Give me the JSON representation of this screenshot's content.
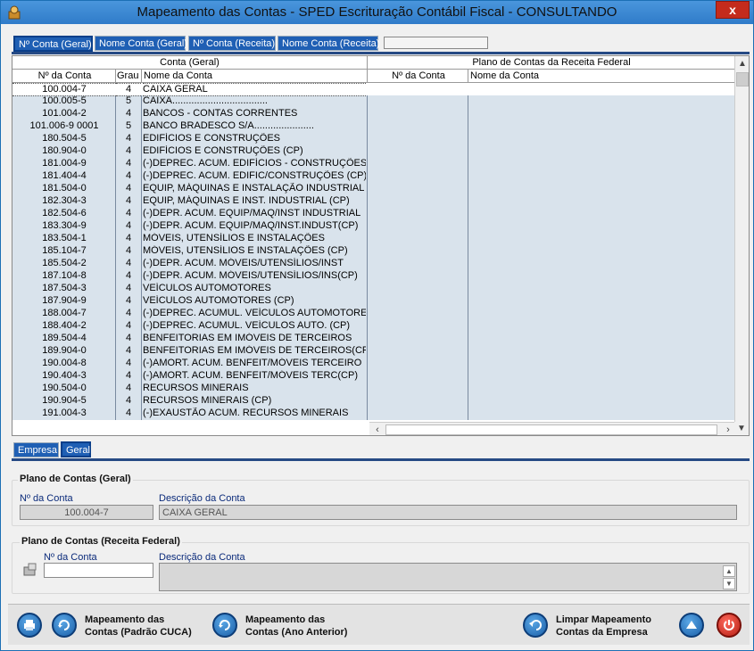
{
  "window": {
    "title": "Mapeamento das Contas - SPED Escrituração Contábil Fiscal  -  CONSULTANDO",
    "close_label": "x"
  },
  "top_tabs": [
    {
      "label": "Nº Conta (Geral)"
    },
    {
      "label": "Nome Conta (Geral)"
    },
    {
      "label": "Nº Conta (Receita)"
    },
    {
      "label": "Nome Conta (Receita)"
    }
  ],
  "grid": {
    "group_left": "Conta (Geral)",
    "group_right": "Plano de Contas da Receita Federal",
    "headers": [
      "Nº da Conta",
      "Grau",
      "Nome da Conta",
      "Nº da Conta",
      "Nome da Conta"
    ],
    "rows": [
      [
        "100.004-7",
        "4",
        "CAIXA GERAL"
      ],
      [
        "100.005-5",
        "5",
        "CAIXA..................................."
      ],
      [
        "101.004-2",
        "4",
        "BANCOS - CONTAS CORRENTES"
      ],
      [
        "101.006-9 0001",
        "5",
        "BANCO BRADESCO S/A......................"
      ],
      [
        "180.504-5",
        "4",
        "EDIFÍCIOS E CONSTRUÇÕES"
      ],
      [
        "180.904-0",
        "4",
        "EDIFÍCIOS E CONSTRUÇÕES (CP)"
      ],
      [
        "181.004-9",
        "4",
        "(-)DEPREC. ACUM. EDIFÍCIOS - CONSTRUÇÕES"
      ],
      [
        "181.404-4",
        "4",
        "(-)DEPREC. ACUM. EDIFIC/CONSTRUÇÕES (CP)"
      ],
      [
        "181.504-0",
        "4",
        "EQUIP, MÁQUINAS E INSTALAÇÃO INDUSTRIAL"
      ],
      [
        "182.304-3",
        "4",
        "EQUIP, MÁQUINAS E INST. INDUSTRIAL (CP)"
      ],
      [
        "182.504-6",
        "4",
        "(-)DEPR. ACUM. EQUIP/MAQ/INST INDUSTRIAL"
      ],
      [
        "183.304-9",
        "4",
        "(-)DEPR. ACUM. EQUIP/MAQ/INST.INDUST(CP)"
      ],
      [
        "183.504-1",
        "4",
        "MÓVEIS, UTENSÍLIOS E INSTALAÇÕES"
      ],
      [
        "185.104-7",
        "4",
        "MÓVEIS, UTENSÍLIOS E INSTALAÇÕES (CP)"
      ],
      [
        "185.504-2",
        "4",
        "(-)DEPR. ACUM. MÓVEIS/UTENSÍLIOS/INST"
      ],
      [
        "187.104-8",
        "4",
        "(-)DEPR. ACUM. MÓVEIS/UTENSÍLIOS/INS(CP)"
      ],
      [
        "187.504-3",
        "4",
        "VEÍCULOS AUTOMOTORES"
      ],
      [
        "187.904-9",
        "4",
        "VEÍCULOS AUTOMOTORES (CP)"
      ],
      [
        "188.004-7",
        "4",
        "(-)DEPREC. ACUMUL. VEÍCULOS AUTOMOTORES"
      ],
      [
        "188.404-2",
        "4",
        "(-)DEPREC. ACUMUL. VEÍCULOS AUTO. (CP)"
      ],
      [
        "189.504-4",
        "4",
        "BENFEITORIAS EM IMÓVEIS DE TERCEIROS"
      ],
      [
        "189.904-0",
        "4",
        "BENFEITORIAS EM IMÓVEIS DE TERCEIROS(CP)"
      ],
      [
        "190.004-8",
        "4",
        "(-)AMORT. ACUM. BENFEIT/MÓVEIS TERCEIRO"
      ],
      [
        "190.404-3",
        "4",
        "(-)AMORT. ACUM. BENFEIT/MÓVEIS TERC(CP)"
      ],
      [
        "190.504-0",
        "4",
        "RECURSOS MINERAIS"
      ],
      [
        "190.904-5",
        "4",
        "RECURSOS MINERAIS (CP)"
      ],
      [
        "191.004-3",
        "4",
        "(-)EXAUSTÃO ACUM. RECURSOS MINERAIS"
      ]
    ]
  },
  "bottom_tabs": [
    {
      "label": "Empresa"
    },
    {
      "label": "Geral"
    }
  ],
  "plano_geral": {
    "title": "Plano de Contas (Geral)",
    "num_label": "Nº da Conta",
    "desc_label": "Descrição da Conta",
    "num_value": "100.004-7",
    "desc_value": "CAIXA GERAL"
  },
  "plano_receita": {
    "title": "Plano de Contas (Receita Federal)",
    "num_label": "Nº da Conta",
    "desc_label": "Descrição da Conta",
    "num_value": "",
    "desc_value": ""
  },
  "buttons": {
    "map_cuca_1": "Mapeamento das",
    "map_cuca_2": "Contas (Padrão CUCA)",
    "map_prev_1": "Mapeamento das",
    "map_prev_2": "Contas (Ano Anterior)",
    "clear_1": "Limpar Mapeamento",
    "clear_2": "Contas da Empresa"
  },
  "icons": [
    "printer-icon",
    "refresh-icon",
    "refresh-icon",
    "undo-icon",
    "up-arrow-icon",
    "power-icon"
  ]
}
